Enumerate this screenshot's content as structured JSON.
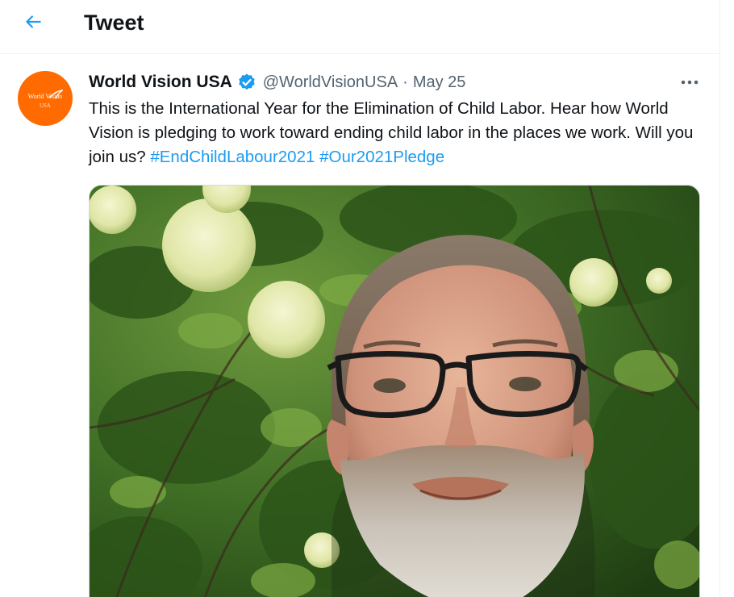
{
  "header": {
    "title": "Tweet"
  },
  "icons": {
    "back": "arrow-left-icon",
    "verified": "verified-badge-icon",
    "more": "more-horizontal-icon"
  },
  "colors": {
    "accent": "#1d9bf0",
    "avatar_bg": "#ff6b00",
    "text_primary": "#0f1419",
    "text_secondary": "#536471"
  },
  "tweet": {
    "author": {
      "name": "World Vision USA",
      "handle": "@WorldVisionUSA",
      "verified": true,
      "avatar_text": "World Vision",
      "avatar_sub": "USA"
    },
    "separator": "·",
    "date": "May 25",
    "text": "This is the International Year for the Elimination of Child Labor. Hear how World Vision is pledging to work toward ending child labor in the places we work. Will you join us? ",
    "hashtags": [
      "#EndChildLabour2021",
      "#Our2021Pledge"
    ]
  }
}
